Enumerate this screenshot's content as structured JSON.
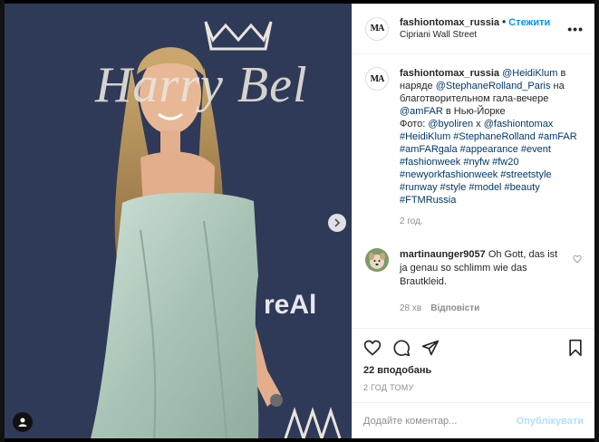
{
  "post": {
    "username": "fashiontomax_russia",
    "follow_label": "Стежити",
    "separator": "•",
    "location": "Cipriani Wall Street",
    "more_label": "•••",
    "avatar_text": "MA"
  },
  "photo": {
    "backdrop_text": "Harry Bel",
    "backdrop_text2": "reAl",
    "next_icon": "chevron-right-icon",
    "tag_icon": "user-icon"
  },
  "caption": {
    "username": "fashiontomax_russia",
    "mention": "@HeidiKlum",
    "text1": " в наряде ",
    "mention2": "@StephaneRolland_Paris",
    "text2": " на благотворительном гала-вечере ",
    "mention3": "@amFAR",
    "text3": " в Нью-Йорке",
    "text4": "Фото: ",
    "mention4": "@byoliren",
    "text5": " x ",
    "mention5": "@fashiontomax",
    "hashtags": "#HeidiKlum #StephaneRolland #amFAR #amFARgala #appearance #event #fashionweek #nyfw #fw20 #newyorkfashionweek #streetstyle #runway #style #model #beauty #FTMRussia",
    "time": "2 год."
  },
  "comment": {
    "username": "martinaunger9057",
    "text": " Oh Gott, das ist ja genau so schlimm wie das Brautkleid.",
    "time": "28 хв",
    "reply_label": "Відповісти"
  },
  "actions": {
    "likes": "22 вподобань",
    "timestamp": "2 ГОД ТОМУ"
  },
  "add_comment": {
    "placeholder": "Додайте коментар...",
    "post_label": "Опублікувати"
  },
  "colors": {
    "accent": "#0095f6",
    "link": "#00376b",
    "muted": "#8e8e8e",
    "post_disabled": "#b2dffc"
  }
}
